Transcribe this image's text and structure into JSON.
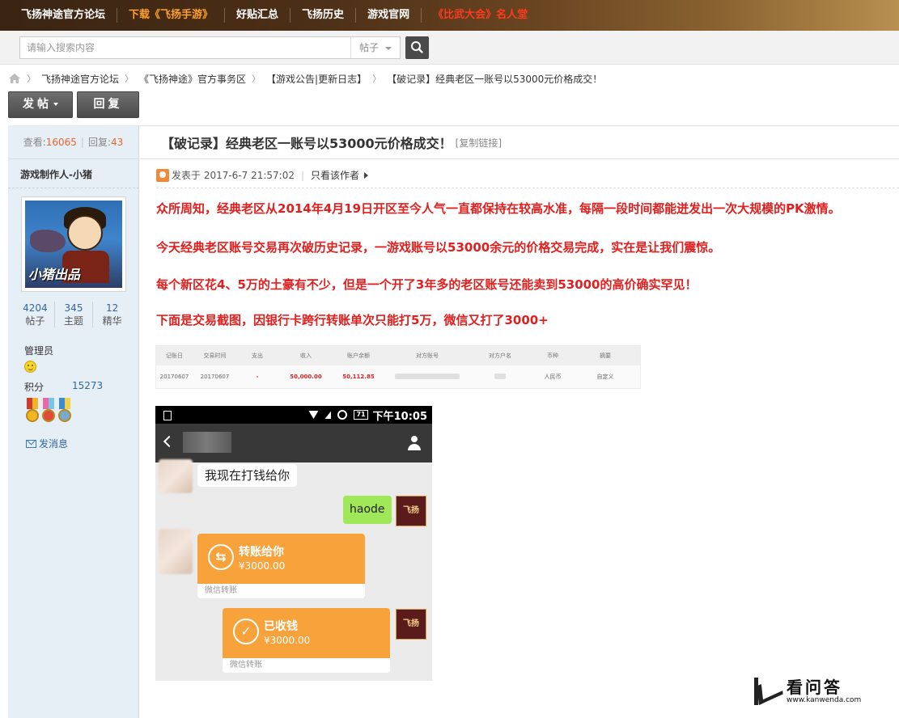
{
  "topnav": {
    "items": [
      {
        "label": "飞扬神途官方论坛",
        "color": "#ffffff"
      },
      {
        "label": "下载《飞扬手游》",
        "color": "#ffa02a"
      },
      {
        "label": "好贴汇总",
        "color": "#ffffff"
      },
      {
        "label": "飞扬历史",
        "color": "#ffffff"
      },
      {
        "label": "游戏官网",
        "color": "#ffffff"
      },
      {
        "label": "《比武大会》名人堂",
        "color": "#ff3b1f"
      }
    ]
  },
  "search": {
    "placeholder": "请输入搜索内容",
    "type_selected": "帖子",
    "button_icon": "search-icon"
  },
  "breadcrumb": {
    "home_icon": "home-icon",
    "items": [
      "飞扬神途官方论坛",
      "《飞扬神途》官方事务区",
      "【游戏公告|更新日志】",
      "【破记录】经典老区一账号以53000元价格成交！"
    ]
  },
  "actions": {
    "post_label": "发帖",
    "reply_label": "回复"
  },
  "thread_stats": {
    "views_label": "查看:",
    "views": "16065",
    "replies_label": "回复:",
    "replies": "43"
  },
  "author": {
    "name": "游戏制作人-小猪",
    "avatar_text": "小猪出品",
    "counts": [
      {
        "value": "4204",
        "label": "帖子"
      },
      {
        "value": "345",
        "label": "主题"
      },
      {
        "value": "12",
        "label": "精华"
      }
    ],
    "role": "管理员",
    "points_label": "积分",
    "points": "15273",
    "pm_label": "发消息"
  },
  "post": {
    "title": "【破记录】经典老区一账号以53000元价格成交！",
    "copy_link": "[复制链接]",
    "posted_at": "发表于 2017-6-7 21:57:02",
    "only_author": "只看该作者",
    "paragraphs": [
      "众所周知，经典老区从2014年4月19日开区至今人气一直都保持在较高水准，每隔一段时间都能迸发出一次大规模的PK激情。",
      "今天经典老区账号交易再次破历史记录，一游戏账号以53000余元的价格交易完成，实在是让我们震惊。",
      "每个新区花4、5万的土豪有不少，但是一个开了3年多的老区账号还能卖到53000的高价确实罕见！",
      "下面是交易截图，因银行卡跨行转账单次只能打5万，微信又打了3000+"
    ]
  },
  "transaction": {
    "headers": [
      "记账日",
      "交易时间",
      "支出",
      "收入",
      "账户余额",
      "对方账号",
      "对方户名",
      "币种",
      "摘要"
    ],
    "row": [
      "20170607",
      "20170607",
      "-",
      "50,000.00",
      "50,112.85",
      "",
      "",
      "人民币",
      "自定义"
    ]
  },
  "phone": {
    "status_time": "下午10:05",
    "battery": "71",
    "messages": {
      "incoming_text": "我现在打钱给你",
      "outgoing_text": "haode",
      "transfer_title": "转账给你",
      "transfer_amount": "¥3000.00",
      "transfer_footer": "微信转账",
      "received_title": "已收钱",
      "received_amount": "¥3000.00",
      "received_footer": "微信转账",
      "game_avatar_text": "飞扬"
    }
  },
  "watermark": {
    "big": "看问答",
    "small": "www.kanwenda.com"
  }
}
